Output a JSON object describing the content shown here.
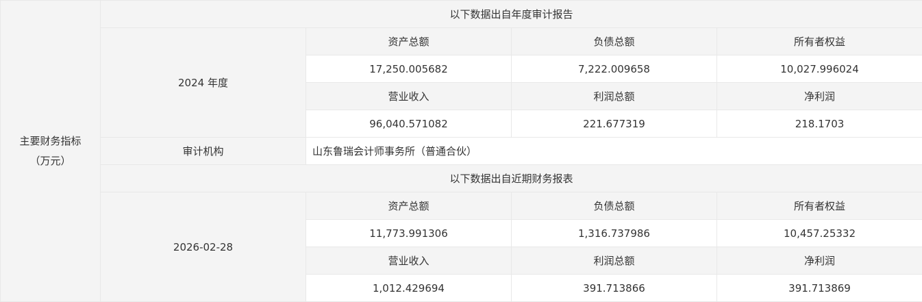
{
  "section_label_line1": "主要财务指标",
  "section_label_line2": "（万元）",
  "audit_header": "以下数据出自年度审计报告",
  "audit": {
    "period": "2024 年度",
    "headers_row1": [
      "资产总额",
      "负债总额",
      "所有者权益"
    ],
    "values_row1": [
      "17,250.005682",
      "7,222.009658",
      "10,027.996024"
    ],
    "headers_row2": [
      "营业收入",
      "利润总额",
      "净利润"
    ],
    "values_row2": [
      "96,040.571082",
      "221.677319",
      "218.1703"
    ]
  },
  "auditor": {
    "label": "审计机构",
    "value": "山东鲁瑞会计师事务所（普通合伙）"
  },
  "recent_header": "以下数据出自近期财务报表",
  "recent": {
    "period": "2026-02-28",
    "headers_row1": [
      "资产总额",
      "负债总额",
      "所有者权益"
    ],
    "values_row1": [
      "11,773.991306",
      "1,316.737986",
      "10,457.25332"
    ],
    "headers_row2": [
      "营业收入",
      "利润总额",
      "净利润"
    ],
    "values_row2": [
      "1,012.429694",
      "391.713866",
      "391.713869"
    ]
  },
  "colors": {
    "header_bg": "#f4f4f4",
    "cell_bg": "#ffffff",
    "border": "#e8e8e8",
    "text": "#333333"
  }
}
